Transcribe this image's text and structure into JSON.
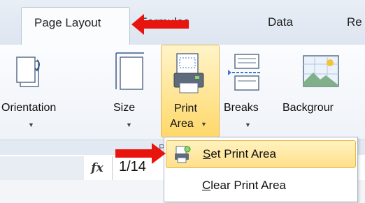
{
  "tabs": [
    {
      "label": "Page Layout",
      "active": true
    },
    {
      "label": "Formulas"
    },
    {
      "label": "Data"
    },
    {
      "label": "Re"
    }
  ],
  "ribbon": {
    "commands": [
      {
        "label": "Orientation",
        "has_dropdown": true,
        "icon": "orientation-icon"
      },
      {
        "label": "Size",
        "has_dropdown": true,
        "icon": "size-icon"
      },
      {
        "label_line1": "Print",
        "label_line2": "Area",
        "has_dropdown": true,
        "icon": "print-area-icon",
        "highlighted": true
      },
      {
        "label": "Breaks",
        "has_dropdown": true,
        "icon": "breaks-icon"
      },
      {
        "label": "Backgrour",
        "icon": "background-icon"
      }
    ],
    "group_label": "Pa"
  },
  "formula_bar": {
    "fx_label": "fx",
    "value": "1/14"
  },
  "print_area_menu": {
    "items": [
      {
        "accel": "S",
        "rest": "et Print Area",
        "highlighted": true,
        "icon": "set-print-area-icon"
      },
      {
        "accel": "C",
        "rest": "lear Print Area"
      }
    ]
  },
  "annotations": {
    "arrow_color": "#e8150f"
  },
  "colors": {
    "highlight": "#ffe08a",
    "highlight_border": "#e2b659"
  }
}
